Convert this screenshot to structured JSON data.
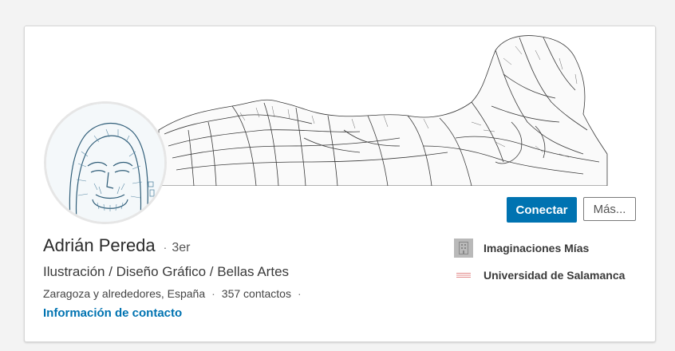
{
  "profile": {
    "name": "Adrián Pereda",
    "degree_separator": "·",
    "degree": "3er",
    "headline": "Ilustración / Diseño Gráfico / Bellas Artes",
    "location": "Zaragoza y alrededores, España",
    "connections": "357 contactos",
    "meta_separator": "·",
    "contact_info_link": "Información de contacto"
  },
  "actions": {
    "connect_label": "Conectar",
    "more_label": "Más..."
  },
  "organizations": [
    {
      "name": "Imaginaciones Mías",
      "icon": "company-building-icon"
    },
    {
      "name": "Universidad de Salamanca",
      "icon": "university-logo-icon"
    }
  ],
  "colors": {
    "primary": "#0073b1",
    "link": "#0073b1",
    "page_background": "#f3f3f3"
  }
}
